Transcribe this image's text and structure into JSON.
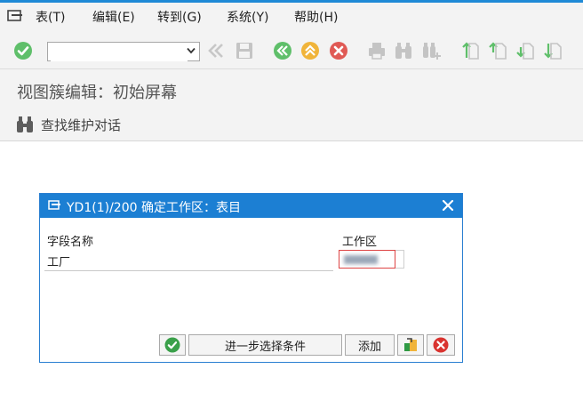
{
  "menu": {
    "items": [
      {
        "label": "表(T)"
      },
      {
        "label": "编辑(E)"
      },
      {
        "label": "转到(G)"
      },
      {
        "label": "系统(Y)"
      },
      {
        "label": "帮助(H)"
      }
    ]
  },
  "toolbar": {
    "command_value": "",
    "icons": [
      "enter-check-icon",
      "command-field-dropdown-icon",
      "double-left-icon",
      "save-icon",
      "back-icon",
      "exit-icon",
      "cancel-icon",
      "print-icon",
      "find-icon",
      "find-next-icon",
      "first-page-icon",
      "previous-page-icon",
      "next-page-icon",
      "last-page-icon"
    ]
  },
  "screen": {
    "title": "视图簇编辑：初始屏幕",
    "find_action": "查找维护对话"
  },
  "dialog": {
    "title": "YD1(1)/200 确定工作区：表目",
    "col_field_name": "字段名称",
    "col_work_area": "工作区",
    "row_label": "工厂",
    "work_area_value": "",
    "buttons": {
      "further_selection": "进一步选择条件",
      "add": "添加"
    }
  },
  "colors": {
    "accent": "#1c7fd3",
    "confirm_green": "#3aa04a",
    "cancel_red": "#d9332f",
    "nav_green": "#5fbf6a",
    "nav_yellow": "#f0b43a"
  }
}
